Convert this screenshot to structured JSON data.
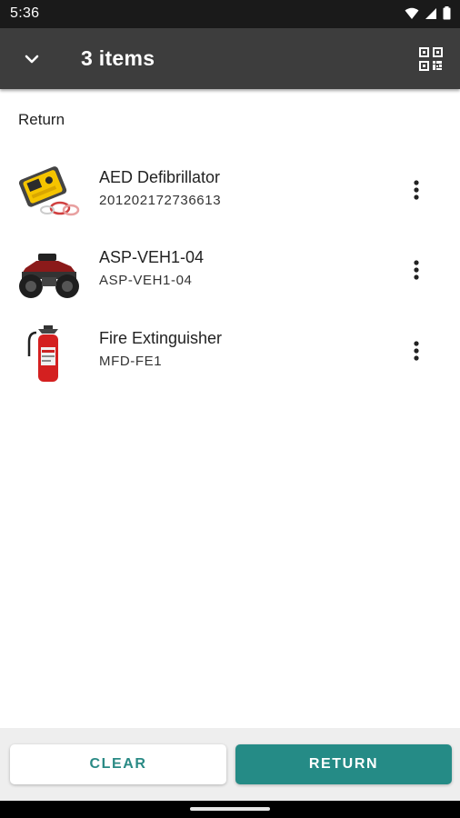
{
  "status_bar": {
    "time": "5:36"
  },
  "app_bar": {
    "title": "3 items"
  },
  "section": {
    "label": "Return"
  },
  "items": [
    {
      "name": "AED Defibrillator",
      "id": "201202172736613",
      "image_icon": "aed-defibrillator-photo"
    },
    {
      "name": "ASP-VEH1-04",
      "id": "ASP-VEH1-04",
      "image_icon": "atv-vehicle-photo"
    },
    {
      "name": "Fire Extinguisher",
      "id": "MFD-FE1",
      "image_icon": "fire-extinguisher-photo"
    }
  ],
  "actions": {
    "clear_label": "CLEAR",
    "return_label": "RETURN"
  },
  "colors": {
    "accent": "#258b86",
    "app_bar": "#3d3d3d",
    "status_bar": "#1a1a1a"
  }
}
